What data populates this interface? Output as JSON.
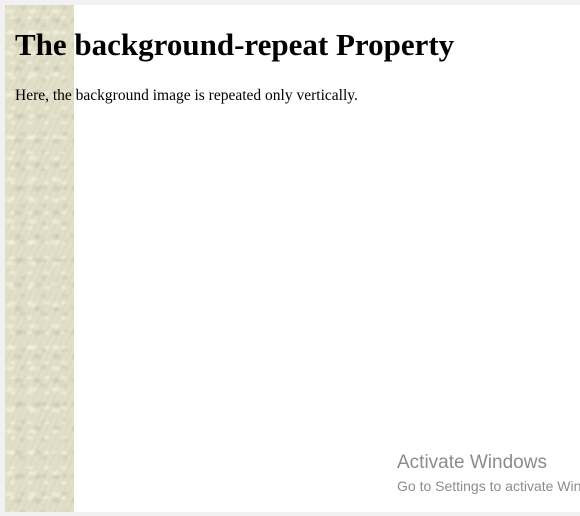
{
  "page": {
    "heading": "The background-repeat Property",
    "paragraph": "Here, the background image is repeated only vertically."
  },
  "overlay": {
    "activate_title": "Activate Windows",
    "activate_subtitle": "Go to Settings to activate Windows."
  },
  "colors": {
    "page_background": "#ffffff",
    "texture_base": "#e2dfc9",
    "watermark_text": "#8c8c8c"
  }
}
